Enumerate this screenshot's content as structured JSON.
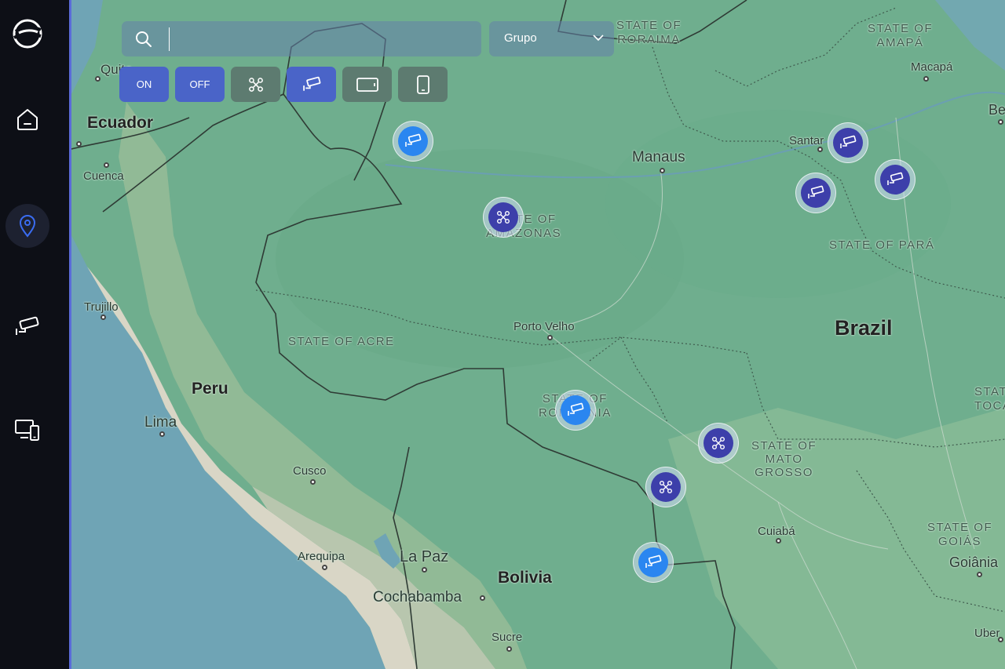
{
  "search": {
    "value": "",
    "placeholder": ""
  },
  "group_select": {
    "value": "Grupo"
  },
  "filters": [
    {
      "label": "ON",
      "active": true
    },
    {
      "label": "OFF",
      "active": true
    },
    {
      "icon": "drone-icon",
      "active": false
    },
    {
      "icon": "camera-icon",
      "active": true
    },
    {
      "icon": "tablet-icon",
      "active": false
    },
    {
      "icon": "phone-icon",
      "active": false
    }
  ],
  "sidebar": {
    "items": [
      {
        "icon": "home-icon",
        "active": false
      },
      {
        "icon": "map-pin-icon",
        "active": true
      },
      {
        "icon": "camera-icon",
        "active": false
      },
      {
        "icon": "devices-icon",
        "active": false
      }
    ]
  },
  "map": {
    "labels": {
      "quito": "Quito",
      "ecuador": "Ecuador",
      "cuenca": "Cuenca",
      "trujillo": "Trujillo",
      "peru": "Peru",
      "lima": "Lima",
      "cusco": "Cusco",
      "arequipa": "Arequipa",
      "la_paz": "La Paz",
      "bolivia": "Bolivia",
      "cochabamba": "Cochabamba",
      "sucre": "Sucre",
      "manaus": "Manaus",
      "state_roraima": "STATE OF\nRORAIMA",
      "state_amapa": "STATE OF\nAMAPÁ",
      "macapa": "Macapá",
      "belem": "Bele",
      "santarem": "Santar",
      "state_amazonas": "STATE OF\nAMAZONAS",
      "state_para": "STATE OF PARÁ",
      "brazil": "Brazil",
      "state_acre": "STATE OF ACRE",
      "porto_velho": "Porto Velho",
      "state_rondonia": "STATE OF\nRONDONIA",
      "state_mato_grosso": "STATE OF\nMATO\nGROSSO",
      "cuiaba": "Cuiabá",
      "state_goias": "STATE OF\nGOIÁS",
      "goiania": "Goiânia",
      "state_tocantins": "STAT\nTOCA",
      "uberlandia": "Uber"
    },
    "zoom": {
      "in": "+",
      "out": "−"
    }
  },
  "colors": {
    "sidebar_bg": "#0d0f16",
    "accent": "#5a6bd8",
    "camera_marker": "#2a86f0",
    "drone_marker": "#3d3faa",
    "filter_active": "#4a64c8"
  }
}
